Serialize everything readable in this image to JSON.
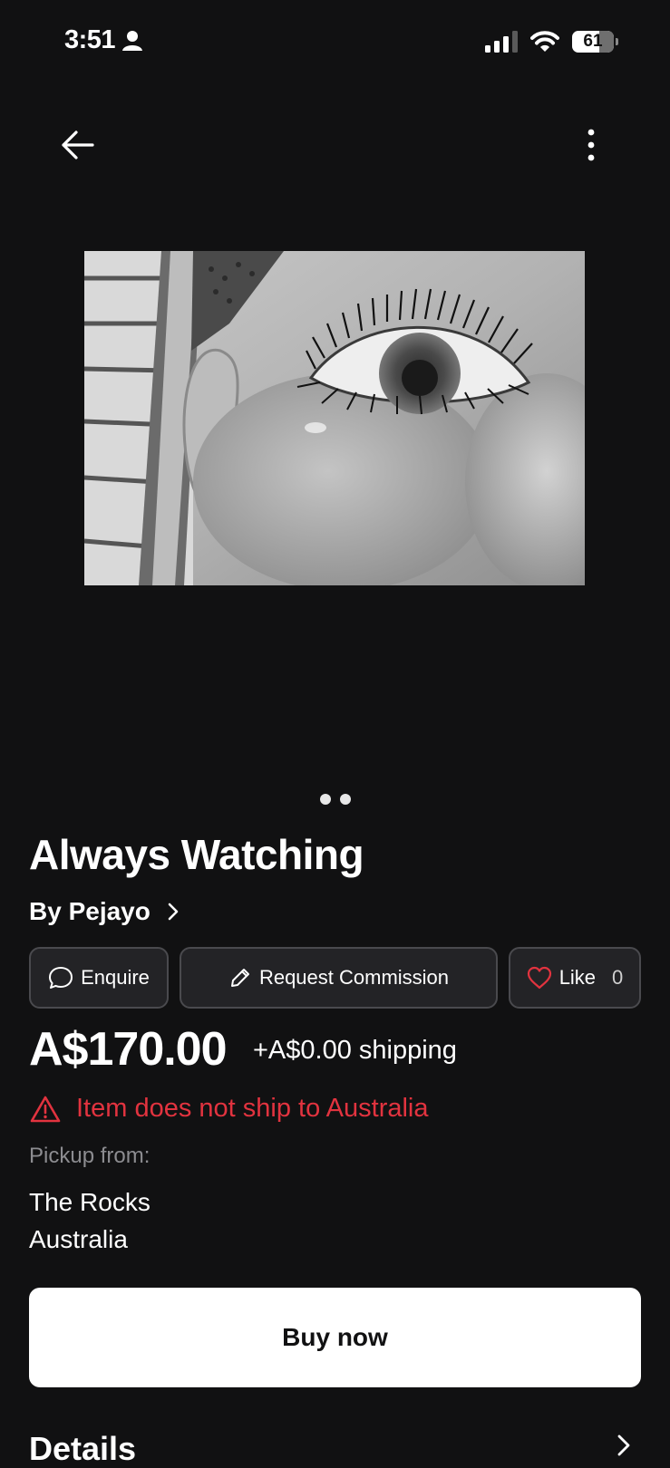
{
  "status_bar": {
    "time": "3:51",
    "battery": "61"
  },
  "artwork": {
    "pager_count": 2,
    "title": "Always Watching",
    "artist_label": "By Pejayo"
  },
  "actions": {
    "enquire": "Enquire",
    "request_commission": "Request Commission",
    "like": "Like",
    "like_count": "0"
  },
  "pricing": {
    "price": "A$170.00",
    "shipping": "+A$0.00 shipping",
    "warning": "Item does not ship to Australia"
  },
  "pickup": {
    "label": "Pickup from:",
    "line1": "The Rocks",
    "line2": "Australia"
  },
  "buy_button": "Buy now",
  "details_heading": "Details",
  "colors": {
    "background": "#111112",
    "warning": "#e2333f",
    "button_border": "#4a4a4e"
  }
}
